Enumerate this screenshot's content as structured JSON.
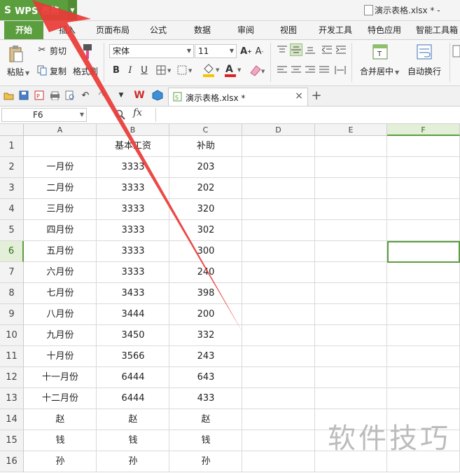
{
  "app": {
    "name": "WPS 表格",
    "logo_letter": "S",
    "document_title": "演示表格.xlsx * -"
  },
  "tabs": [
    {
      "id": "home",
      "label": "开始",
      "active": true
    },
    {
      "id": "insert",
      "label": "插入"
    },
    {
      "id": "layout",
      "label": "页面布局"
    },
    {
      "id": "formulas",
      "label": "公式"
    },
    {
      "id": "data",
      "label": "数据"
    },
    {
      "id": "review",
      "label": "审阅"
    },
    {
      "id": "view",
      "label": "视图"
    },
    {
      "id": "dev",
      "label": "开发工具"
    },
    {
      "id": "special",
      "label": "特色应用"
    },
    {
      "id": "smart",
      "label": "智能工具箱"
    }
  ],
  "ribbon": {
    "paste": "粘贴",
    "cut": "剪切",
    "copy": "复制",
    "format_painter": "格式刷",
    "font_name": "宋体",
    "font_size": "11",
    "merge_center": "合并居中",
    "wrap_text": "自动换行",
    "colors": {
      "fill": "#f5c400",
      "font": "#e02020"
    }
  },
  "doc_tab": {
    "label": "演示表格.xlsx *"
  },
  "formula_bar": {
    "cell_ref": "F6",
    "fx_label": "fx",
    "content": ""
  },
  "columns": [
    "A",
    "B",
    "C",
    "D",
    "E",
    "F"
  ],
  "selected_cell": {
    "column": "F",
    "row": "6"
  },
  "rows": [
    {
      "num": "1",
      "a": "",
      "b": "基本工资",
      "c": "补助"
    },
    {
      "num": "2",
      "a": "一月份",
      "b": "3333",
      "c": "203"
    },
    {
      "num": "3",
      "a": "二月份",
      "b": "3333",
      "c": "202"
    },
    {
      "num": "4",
      "a": "三月份",
      "b": "3333",
      "c": "320"
    },
    {
      "num": "5",
      "a": "四月份",
      "b": "3333",
      "c": "302"
    },
    {
      "num": "6",
      "a": "五月份",
      "b": "3333",
      "c": "300"
    },
    {
      "num": "7",
      "a": "六月份",
      "b": "3333",
      "c": "240"
    },
    {
      "num": "8",
      "a": "七月份",
      "b": "3433",
      "c": "398"
    },
    {
      "num": "9",
      "a": "八月份",
      "b": "3444",
      "c": "200"
    },
    {
      "num": "10",
      "a": "九月份",
      "b": "3450",
      "c": "332"
    },
    {
      "num": "11",
      "a": "十月份",
      "b": "3566",
      "c": "243"
    },
    {
      "num": "12",
      "a": "十一月份",
      "b": "6444",
      "c": "643"
    },
    {
      "num": "13",
      "a": "十二月份",
      "b": "6444",
      "c": "433"
    },
    {
      "num": "14",
      "a": "赵",
      "b": "赵",
      "c": "赵"
    },
    {
      "num": "15",
      "a": "钱",
      "b": "钱",
      "c": "钱"
    },
    {
      "num": "16",
      "a": "孙",
      "b": "孙",
      "c": "孙"
    }
  ],
  "watermark": "软件技巧",
  "annotation": {
    "arrow_color": "#e83a36"
  }
}
